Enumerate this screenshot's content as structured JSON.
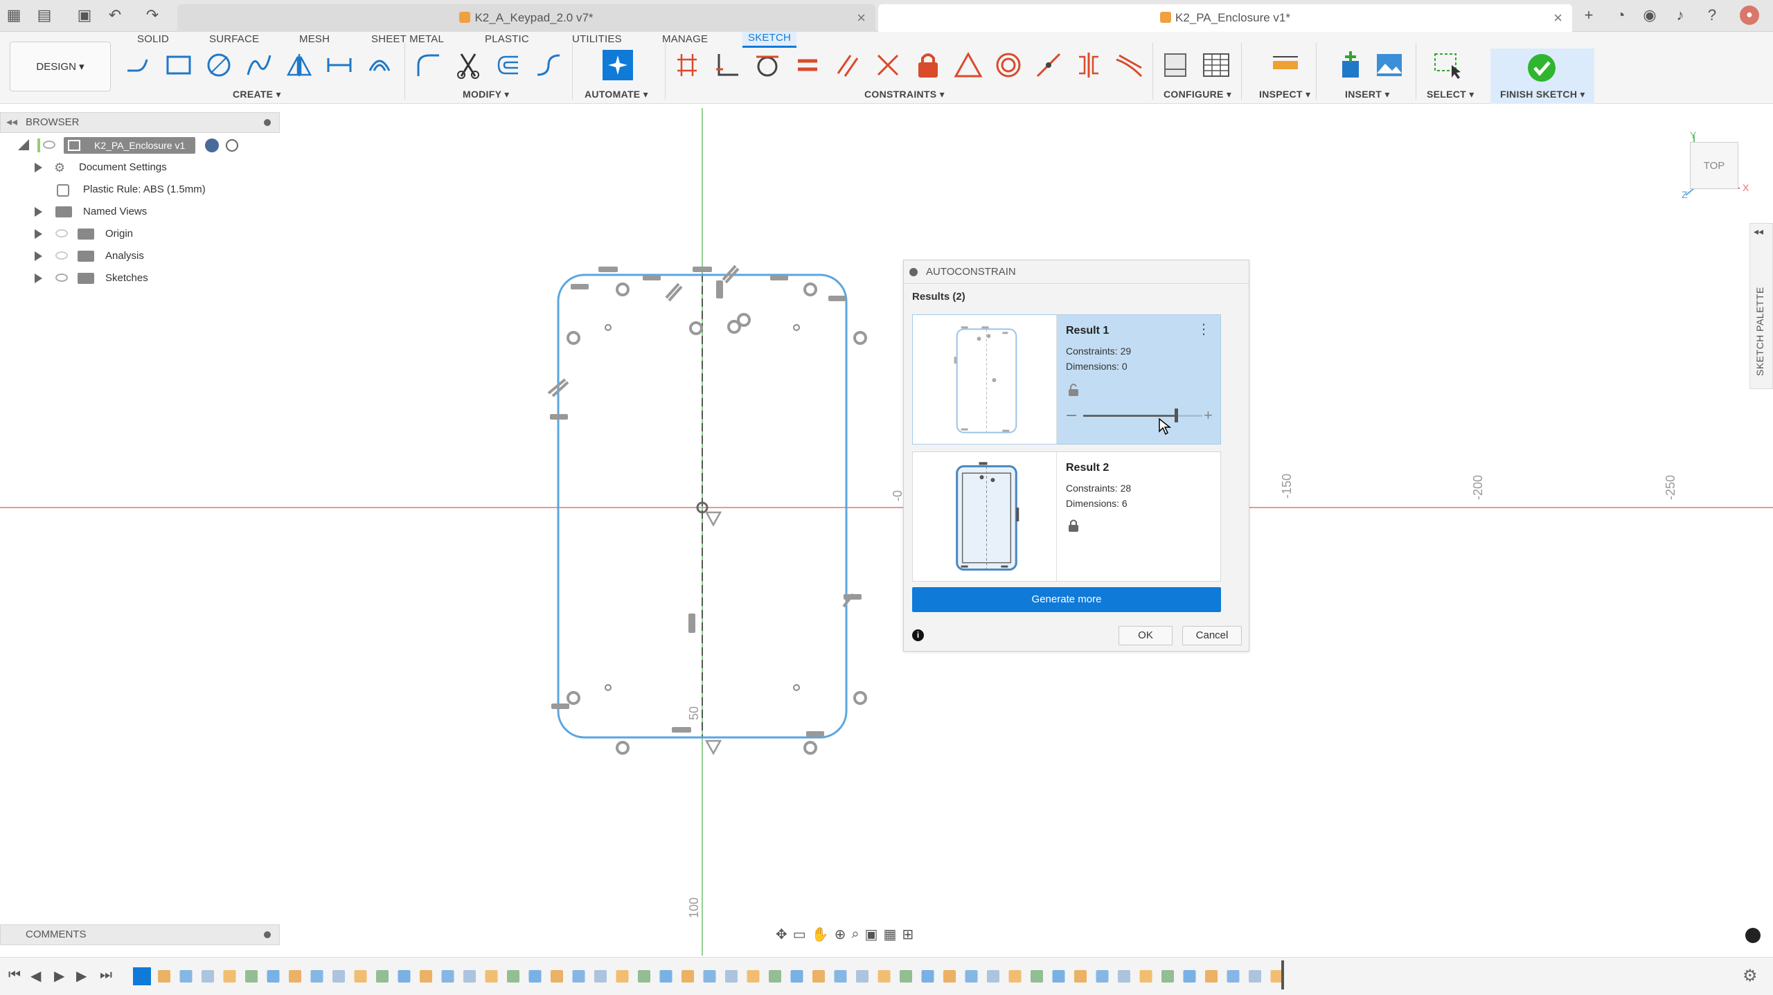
{
  "titlebar": {
    "tabs": [
      {
        "label": "K2_A_Keypad_2.0 v7*",
        "active": false
      },
      {
        "label": "K2_PA_Enclosure v1*",
        "active": true
      }
    ]
  },
  "toolbar": {
    "workspace": "DESIGN ▾",
    "tabs": [
      "SOLID",
      "SURFACE",
      "MESH",
      "SHEET METAL",
      "PLASTIC",
      "UTILITIES",
      "MANAGE",
      "SKETCH"
    ],
    "active_tab": "SKETCH",
    "groups": [
      "CREATE ▾",
      "MODIFY ▾",
      "AUTOMATE ▾",
      "CONSTRAINTS ▾",
      "CONFIGURE ▾",
      "INSPECT ▾",
      "INSERT ▾",
      "SELECT ▾",
      "FINISH SKETCH ▾"
    ]
  },
  "browser": {
    "title": "BROWSER",
    "root": "K2_PA_Enclosure v1",
    "items": [
      "Document Settings",
      "Plastic Rule: ABS (1.5mm)",
      "Named Views",
      "Origin",
      "Analysis",
      "Sketches"
    ]
  },
  "canvas": {
    "ruler_labels": [
      "-150",
      "-200",
      "-250",
      "50",
      "100",
      "-0"
    ],
    "viewcube": "TOP",
    "axis_y": "Y",
    "axis_x": "X",
    "axis_z": "Z",
    "sketch_palette": "SKETCH PALETTE"
  },
  "dialog": {
    "title": "AUTOCONSTRAIN",
    "results_label": "Results (2)",
    "results": [
      {
        "name": "Result 1",
        "constraints": "Constraints: 29",
        "dimensions": "Dimensions: 0",
        "selected": true,
        "slider_fraction": 0.78
      },
      {
        "name": "Result 2",
        "constraints": "Constraints: 28",
        "dimensions": "Dimensions: 6",
        "selected": false
      }
    ],
    "generate_label": "Generate more",
    "ok_label": "OK",
    "cancel_label": "Cancel"
  },
  "comments": {
    "title": "COMMENTS"
  },
  "colors": {
    "accent": "#0f7ad8",
    "finish_green": "#2fb52f",
    "sketch_blue": "#5aa6e0",
    "axis_red": "#e87070",
    "axis_green": "#6fc26f"
  }
}
